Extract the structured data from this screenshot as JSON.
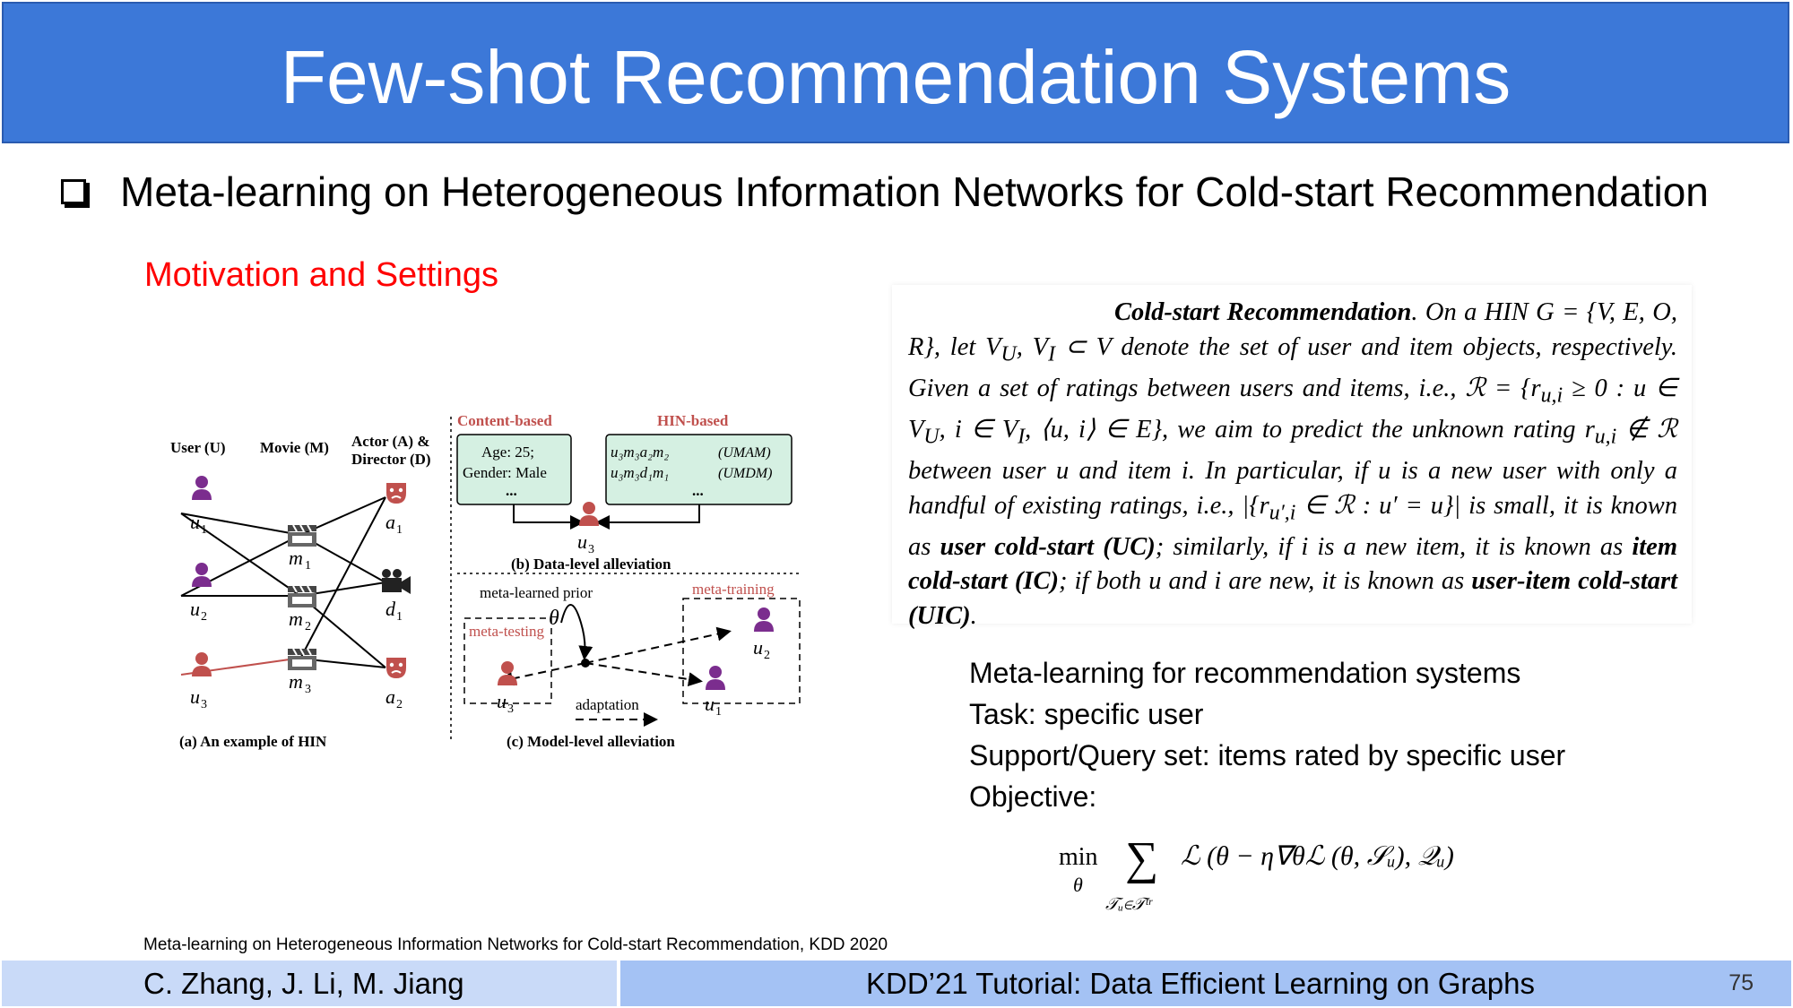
{
  "slide": {
    "title": "Few-shot Recommendation Systems",
    "bullet": "Meta-learning on Heterogeneous Information Networks for Cold-start Recommendation",
    "section_label": "Motivation and Settings",
    "citation": "Meta-learning on Heterogeneous Information Networks for Cold-start Recommendation, KDD 2020",
    "page_number": "75"
  },
  "figure": {
    "headers": {
      "user": "User (U)",
      "movie": "Movie (M)",
      "actor_director_1": "Actor (A) &",
      "actor_director_2": "Director (D)",
      "content_based": "Content-based",
      "hin_based": "HIN-based"
    },
    "content_box": [
      "Age: 25;",
      "Gender: Male",
      "..."
    ],
    "hin_box": [
      "(UMAM)",
      "(UMDM)",
      "..."
    ],
    "captions": {
      "a": "(a) An example of HIN",
      "b": "(b) Data-level alleviation",
      "c": "(c) Model-level alleviation"
    },
    "labels": {
      "meta_prior": "meta-learned prior",
      "meta_training": "meta-training",
      "meta_testing": "meta-testing",
      "adaptation": "adaptation"
    }
  },
  "definition": {
    "title": "Cold-start Recommendation",
    "uc": "user cold-start (UC)",
    "ic": "item cold-start (IC)",
    "uic": "user-item cold-start (UIC)"
  },
  "meta_points": [
    "Meta-learning for recommendation systems",
    "Task: specific user",
    "Support/Query set: items rated by specific user",
    "Objective:"
  ],
  "footer": {
    "authors": "C. Zhang, J. Li, M. Jiang",
    "tutorial": "KDD’21 Tutorial: Data Efficient Learning on Graphs"
  }
}
